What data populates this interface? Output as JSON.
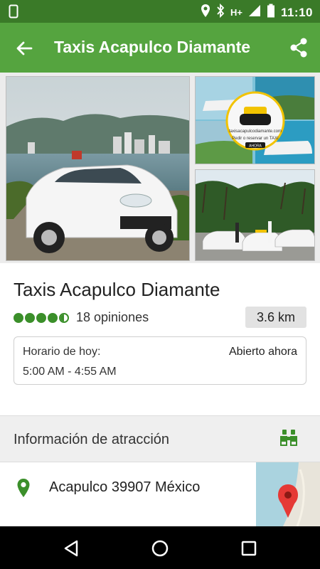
{
  "status_bar": {
    "time": "11:10",
    "network_label": "H+",
    "icons": [
      "phone-outline-icon",
      "location-pin-icon",
      "bluetooth-icon",
      "signal-icon",
      "battery-icon"
    ]
  },
  "app_bar": {
    "title": "Taxis Acapulco Diamante",
    "background": "#55a43f"
  },
  "gallery": {
    "photos": [
      "white-sedan-taxi-bay",
      "taxi-logo-collage",
      "taxi-fleet-palm-trees"
    ],
    "logo_text": "Pedir o reservar un TAXI",
    "logo_url_text": "taxisacapulcodiamante.com",
    "logo_button": "AHORA"
  },
  "attraction": {
    "name": "Taxis Acapulco Diamante",
    "rating": 4.5,
    "rating_max": 5,
    "reviews": "18 opiniones",
    "distance": "3.6 km",
    "rating_color": "#3b8f2a"
  },
  "hours": {
    "label": "Horario de hoy:",
    "status": "Abierto ahora",
    "range": "5:00 AM - 4:55 AM"
  },
  "section": {
    "title": "Información de atracción"
  },
  "address": {
    "text": "Acapulco 39907 México",
    "pin_color": "#3b8f2a"
  },
  "nav_bar": {
    "buttons": [
      "back-triangle-icon",
      "home-circle-icon",
      "recents-square-icon"
    ]
  }
}
